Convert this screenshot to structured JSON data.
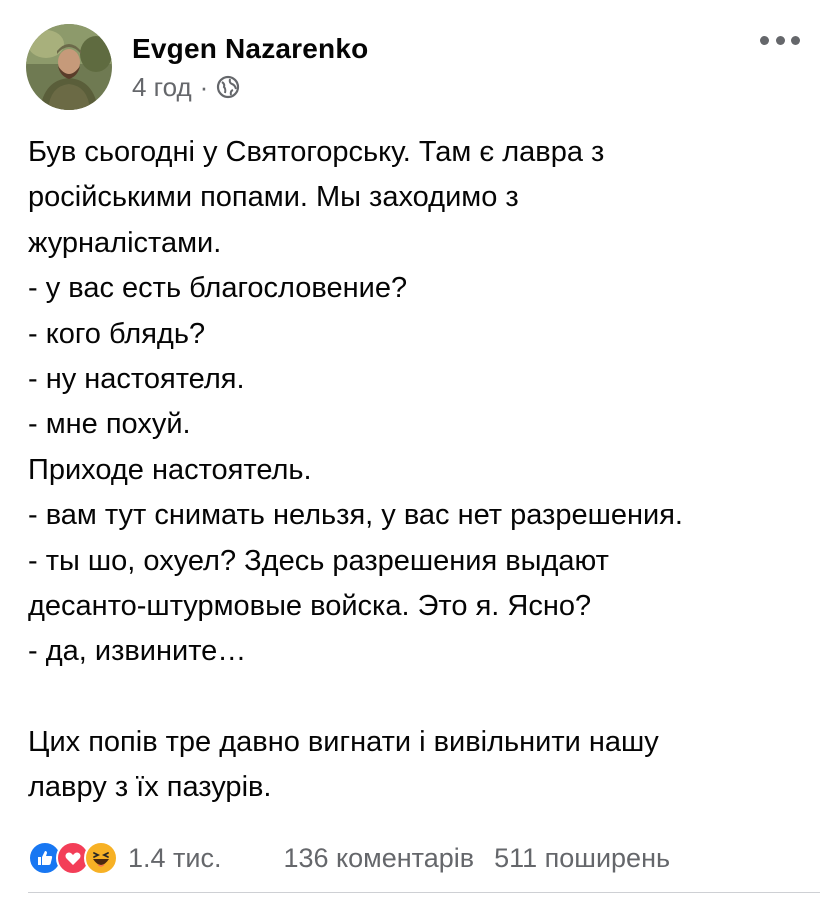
{
  "post": {
    "author": "Evgen Nazarenko",
    "time": "4 год",
    "separator": "·",
    "audience_icon": "globe-icon",
    "more_icon": "more-options-icon",
    "lines": [
      "Був сьогодні у Святогорську. Там є лавра з",
      "російськими попами. Мы заходимо з",
      "журналістами.",
      "- у вас есть благословение?",
      "- кого блядь?",
      "- ну настоятеля.",
      "- мне похуй.",
      "Приходе настоятель.",
      "- вам тут снимать нельзя, у вас нет разрешения.",
      "- ты шо, охуел? Здесь разрешения выдают",
      "десанто-штурмовые войска. Это я. Ясно?",
      "- да, извините…",
      "",
      "Цих попів тре давно вигнати і вивільнити нашу",
      "лавру з їх пазурів."
    ]
  },
  "footer": {
    "reaction_icons": [
      "like-icon",
      "love-icon",
      "haha-icon"
    ],
    "reaction_count": "1.4 тис.",
    "comments": "136 коментарів",
    "shares": "511 поширень"
  },
  "colors": {
    "like": "#1877f2",
    "love": "#f33e58",
    "haha": "#f7b125",
    "secondary_text": "#65676b"
  }
}
